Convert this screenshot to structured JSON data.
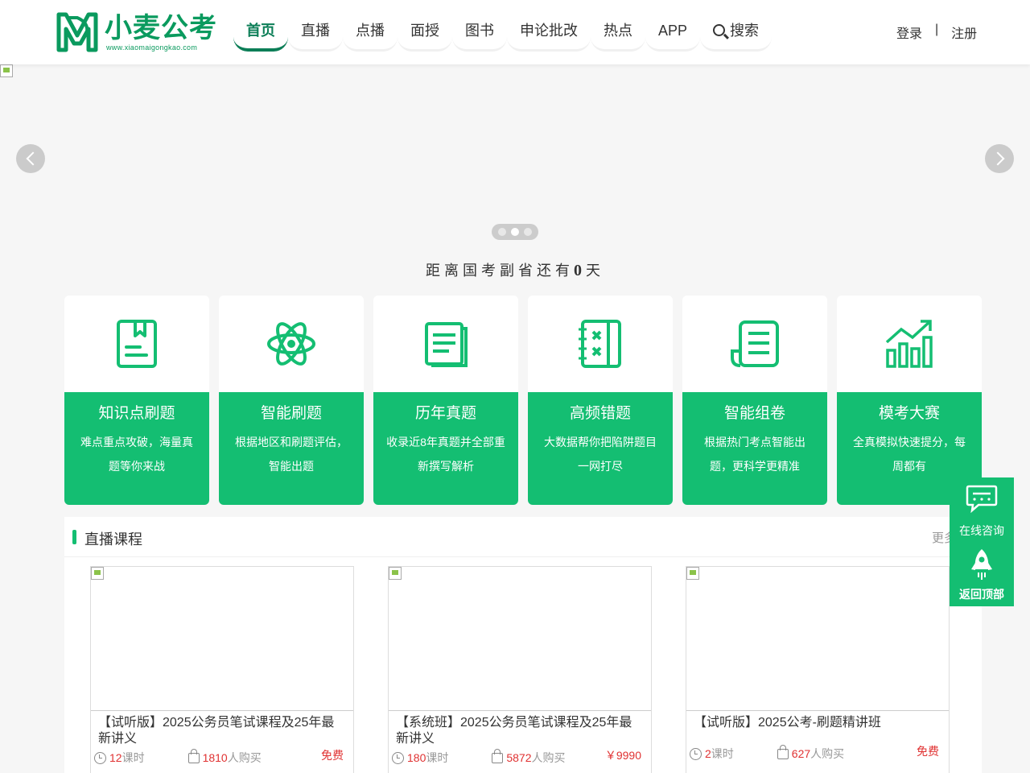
{
  "brand": {
    "name": "小麦公考",
    "url": "www.xiaomaigongkao.com",
    "color": "#0a9a5e",
    "accent": "#14be72"
  },
  "nav": {
    "items": [
      {
        "label": "首页",
        "active": true
      },
      {
        "label": "直播"
      },
      {
        "label": "点播"
      },
      {
        "label": "面授"
      },
      {
        "label": "图书"
      },
      {
        "label": "申论批改"
      },
      {
        "label": "热点"
      },
      {
        "label": "APP"
      }
    ],
    "search_label": "搜索"
  },
  "auth": {
    "login": "登录",
    "separator": "|",
    "register": "注册"
  },
  "banner": {
    "active_dot": 2,
    "dot_count": 3
  },
  "countdown": {
    "prefix": "距离国考副省还有",
    "days": "0",
    "suffix": "天"
  },
  "features": [
    {
      "title": "知识点刷题",
      "desc": "难点重点攻破，海量真题等你来战",
      "icon": "book-bookmark-icon"
    },
    {
      "title": "智能刷题",
      "desc": "根据地区和刷题评估，智能出题",
      "icon": "atom-icon"
    },
    {
      "title": "历年真题",
      "desc": "收录近8年真题并全部重新撰写解析",
      "icon": "books-icon"
    },
    {
      "title": "高频错题",
      "desc": "大数据帮你把陷阱题目一网打尽",
      "icon": "wrong-notebook-icon"
    },
    {
      "title": "智能组卷",
      "desc": "根据热门考点智能出题，更科学更精准",
      "icon": "paper-scroll-icon"
    },
    {
      "title": "模考大赛",
      "desc": "全真模拟快速提分，每周都有",
      "icon": "growth-chart-icon"
    }
  ],
  "live_section": {
    "title": "直播课程",
    "more": "更多",
    "courses": [
      {
        "name": "【试听版】2025公务员笔试课程及25年最新讲义",
        "hours": "12",
        "hours_unit": "课时",
        "buyers": "1810",
        "buyers_unit": "人购买",
        "price": "免费"
      },
      {
        "name": "【系统班】2025公务员笔试课程及25年最新讲义",
        "hours": "180",
        "hours_unit": "课时",
        "buyers": "5872",
        "buyers_unit": "人购买",
        "price": "￥9990"
      },
      {
        "name": "【试听版】2025公考-刷题精讲班",
        "hours": "2",
        "hours_unit": "课时",
        "buyers": "627",
        "buyers_unit": "人购买",
        "price": "免费"
      }
    ]
  },
  "float_bar": {
    "consult": "在线咨询",
    "top": "返回顶部"
  }
}
